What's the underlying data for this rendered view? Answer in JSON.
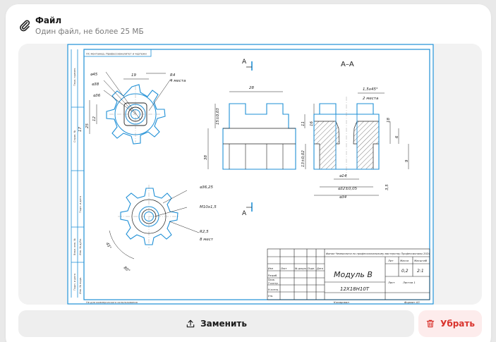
{
  "file": {
    "title": "Файл",
    "subtitle": "Один файл, не более 25 МБ",
    "icon": "paperclip-icon"
  },
  "drawing": {
    "header_note": "ОС монтажер, Профессионалитет и чертежи",
    "section_label": "A–A",
    "cut_label_top": "A",
    "cut_label_bottom": "A",
    "dims": {
      "d_outer": "⌀45",
      "d_mid": "⌀38",
      "d_inner": "⌀36",
      "width_19": "19",
      "r4": "R4",
      "r4_note": "4 места",
      "left_25": "25",
      "left_12": "12",
      "left_17": "17",
      "w28": "28",
      "h15": "15±0,03",
      "h11": "11",
      "h16": "16",
      "h38": "38",
      "h13": "13±0,02",
      "chamfer": "1,5x45°",
      "chamfer_note": "2 места",
      "d14": "⌀14",
      "d32": "⌀32±0,05",
      "d34": "⌀34",
      "h18": "18",
      "h6": "6",
      "h9": "9",
      "h35": "3,5",
      "d3625": "⌀36,25",
      "thread": "M10x1,5",
      "r25": "R2,5",
      "r25_note": "8 мест",
      "ang45": "45°",
      "ang80": "80°"
    },
    "titleblock": {
      "org": "Финал Чемпионата по профессиональному мастерству Профессионалы 2024",
      "name": "Модуль B",
      "material": "12Х18Н10Т",
      "col_lit": "Лит",
      "col_mass": "Масса",
      "col_scale": "Масштаб",
      "mass": "0,2",
      "scale": "2:1",
      "sheet": "Лист",
      "sheets": "Листов 1",
      "copied": "Копировал",
      "format": "Формат A3",
      "rows": [
        "Изм",
        "Лист",
        "№ докум.",
        "Подп.",
        "Дата",
        "Разраб.",
        "Пров.",
        "Т.контр.",
        "Н.контр.",
        "Утв."
      ]
    },
    "footer": "Не для коммерческого использования",
    "side_notes": [
      "Перв. примен.",
      "Справ. №",
      "Подп. и дата",
      "Инв. № дубл.",
      "Взам. инв. №",
      "Подп. и дата",
      "Инв. № подл."
    ]
  },
  "actions": {
    "replace_label": "Заменить",
    "remove_label": "Убрать",
    "replace_icon": "upload-icon",
    "remove_icon": "trash-icon"
  },
  "colors": {
    "accent_red": "#d9322c",
    "outline_blue": "#1e8fd6",
    "line_black": "#222222"
  }
}
